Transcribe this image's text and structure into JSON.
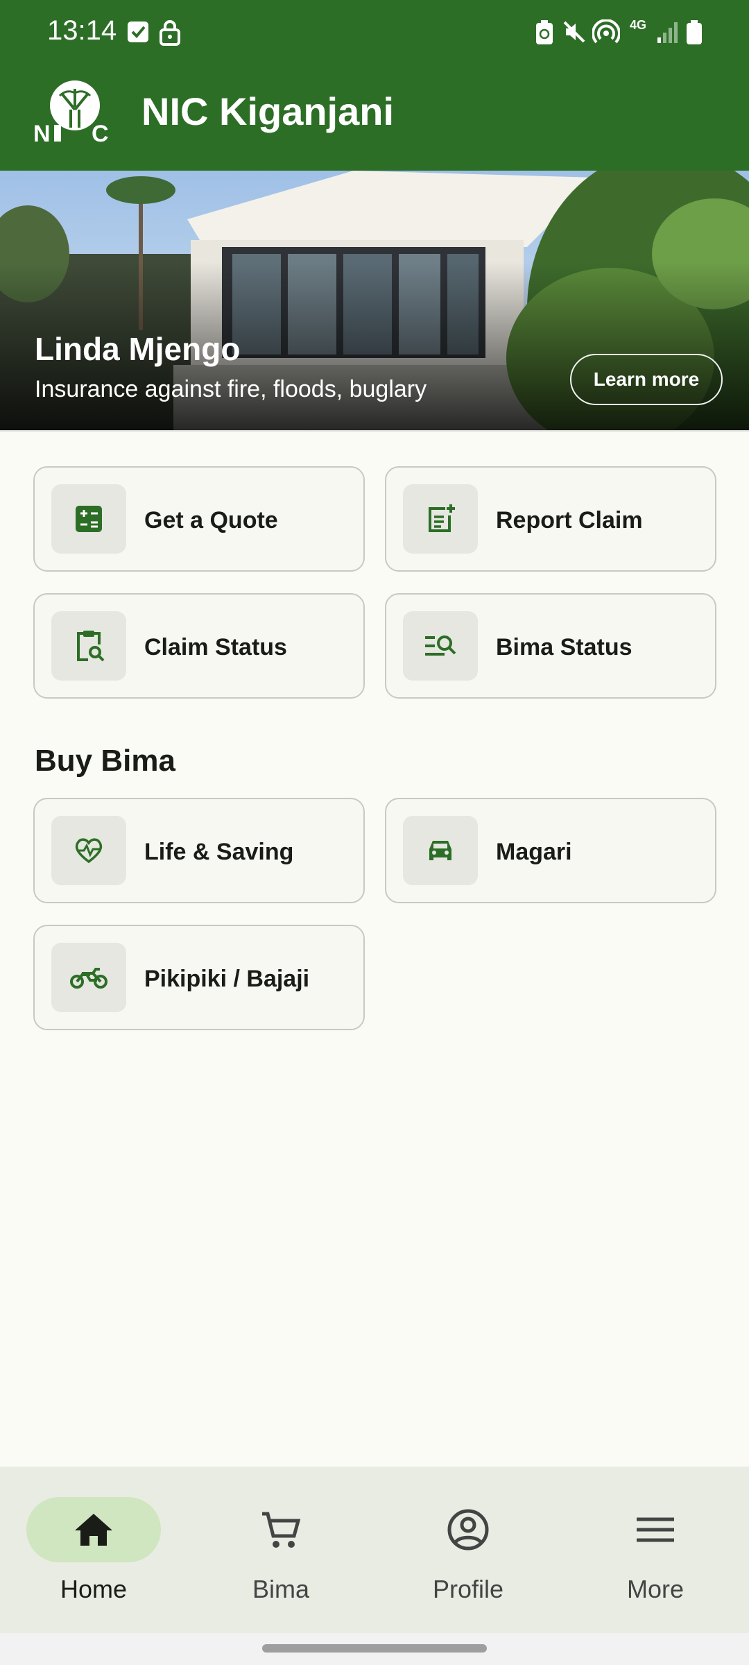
{
  "status_bar": {
    "time": "13:14",
    "network": "4G"
  },
  "app": {
    "title": "NIC Kiganjani",
    "logo_text": "NIC"
  },
  "banner": {
    "title": "Linda Mjengo",
    "subtitle": "Insurance against fire, floods, buglary",
    "button": "Learn more"
  },
  "actions": [
    {
      "label": "Get a Quote",
      "icon": "calculator-icon"
    },
    {
      "label": "Report Claim",
      "icon": "add-note-icon"
    },
    {
      "label": "Claim Status",
      "icon": "clipboard-search-icon"
    },
    {
      "label": "Bima Status",
      "icon": "list-search-icon"
    }
  ],
  "buy_bima": {
    "title": "Buy Bima",
    "items": [
      {
        "label": "Life & Saving",
        "icon": "heart-pulse-icon"
      },
      {
        "label": "Magari",
        "icon": "car-icon"
      },
      {
        "label": "Pikipiki / Bajaji",
        "icon": "motorcycle-icon"
      }
    ]
  },
  "bottom_nav": {
    "active": "Home",
    "items": [
      {
        "label": "Home",
        "icon": "home-icon"
      },
      {
        "label": "Bima",
        "icon": "cart-icon"
      },
      {
        "label": "Profile",
        "icon": "account-circle-icon"
      },
      {
        "label": "More",
        "icon": "menu-icon"
      }
    ]
  },
  "colors": {
    "primary": "#2d6e27",
    "background": "#fafbf5",
    "card": "#f7f8f2",
    "nav_active": "#cfe6c0"
  }
}
